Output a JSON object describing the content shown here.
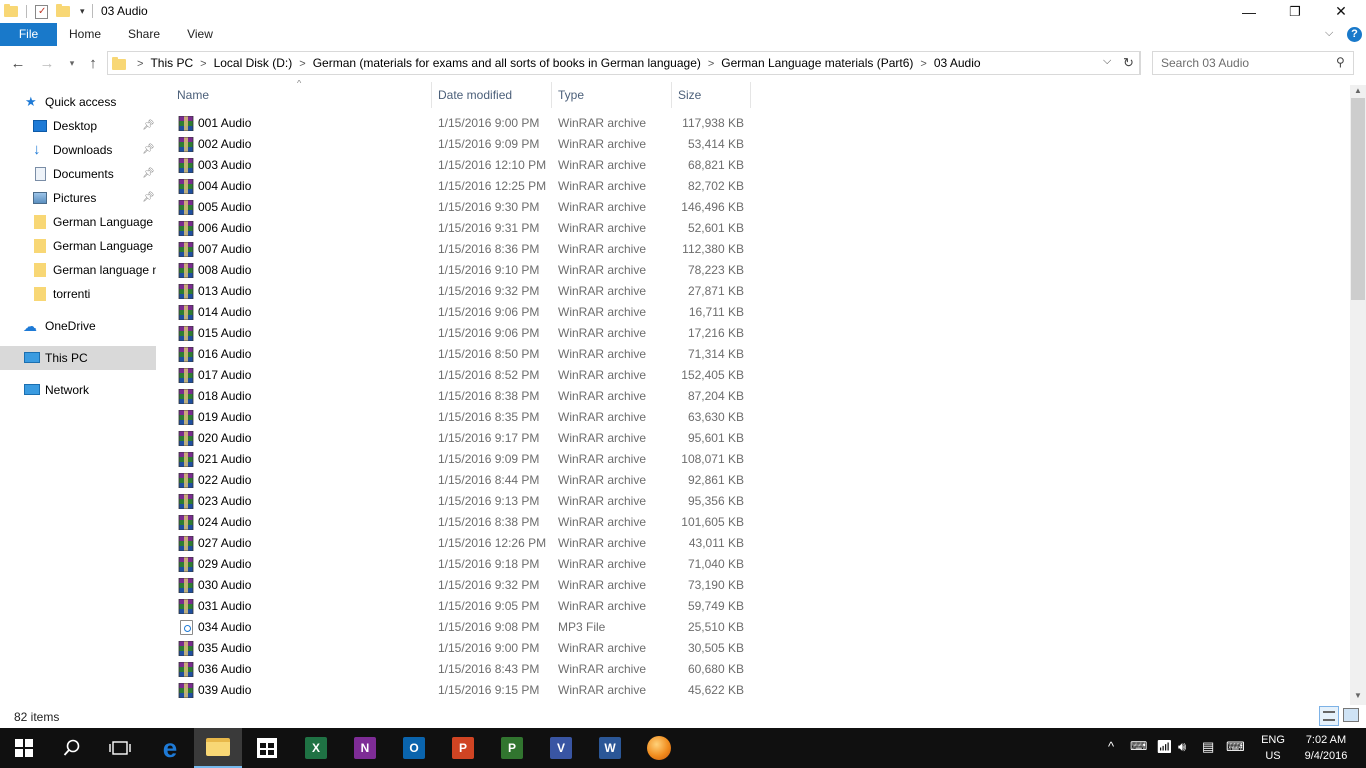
{
  "window": {
    "title": "03 Audio",
    "minimize_glyph": "—",
    "restore_glyph": "❐",
    "close_glyph": "✕",
    "help_glyph": "?",
    "ribbon_expand_glyph": "⌵"
  },
  "ribbon": {
    "tabs": [
      "File",
      "Home",
      "Share",
      "View"
    ]
  },
  "address": {
    "breadcrumbs": [
      "This PC",
      "Local Disk (D:)",
      "German (materials for exams and all sorts of books in German language)",
      "German Language materials (Part6)",
      "03 Audio"
    ],
    "search_placeholder": "Search 03 Audio"
  },
  "nav": {
    "quick_access": "Quick access",
    "items": [
      {
        "label": "Desktop",
        "icon": "desktop-icon",
        "pinned": true
      },
      {
        "label": "Downloads",
        "icon": "downloads-icon",
        "pinned": true
      },
      {
        "label": "Documents",
        "icon": "documents-icon",
        "pinned": true
      },
      {
        "label": "Pictures",
        "icon": "pictures-icon",
        "pinned": true
      },
      {
        "label": "German Language r",
        "icon": "folder-icon",
        "pinned": false
      },
      {
        "label": "German Language r",
        "icon": "folder-icon",
        "pinned": false
      },
      {
        "label": "German language n",
        "icon": "folder-icon",
        "pinned": false
      },
      {
        "label": "torrenti",
        "icon": "folder-icon",
        "pinned": false
      }
    ],
    "onedrive": "OneDrive",
    "this_pc": "This PC",
    "network": "Network"
  },
  "columns": {
    "name": "Name",
    "date": "Date modified",
    "type": "Type",
    "size": "Size"
  },
  "files": [
    {
      "name": "001 Audio",
      "date": "1/15/2016 9:00 PM",
      "type": "WinRAR archive",
      "size": "117,938 KB",
      "icon": "rar"
    },
    {
      "name": "002 Audio",
      "date": "1/15/2016 9:09 PM",
      "type": "WinRAR archive",
      "size": "53,414 KB",
      "icon": "rar"
    },
    {
      "name": "003 Audio",
      "date": "1/15/2016 12:10 PM",
      "type": "WinRAR archive",
      "size": "68,821 KB",
      "icon": "rar"
    },
    {
      "name": "004 Audio",
      "date": "1/15/2016 12:25 PM",
      "type": "WinRAR archive",
      "size": "82,702 KB",
      "icon": "rar"
    },
    {
      "name": "005 Audio",
      "date": "1/15/2016 9:30 PM",
      "type": "WinRAR archive",
      "size": "146,496 KB",
      "icon": "rar"
    },
    {
      "name": "006 Audio",
      "date": "1/15/2016 9:31 PM",
      "type": "WinRAR archive",
      "size": "52,601 KB",
      "icon": "rar"
    },
    {
      "name": "007 Audio",
      "date": "1/15/2016 8:36 PM",
      "type": "WinRAR archive",
      "size": "112,380 KB",
      "icon": "rar"
    },
    {
      "name": "008 Audio",
      "date": "1/15/2016 9:10 PM",
      "type": "WinRAR archive",
      "size": "78,223 KB",
      "icon": "rar"
    },
    {
      "name": "013 Audio",
      "date": "1/15/2016 9:32 PM",
      "type": "WinRAR archive",
      "size": "27,871 KB",
      "icon": "rar"
    },
    {
      "name": "014 Audio",
      "date": "1/15/2016 9:06 PM",
      "type": "WinRAR archive",
      "size": "16,711 KB",
      "icon": "rar"
    },
    {
      "name": "015 Audio",
      "date": "1/15/2016 9:06 PM",
      "type": "WinRAR archive",
      "size": "17,216 KB",
      "icon": "rar"
    },
    {
      "name": "016 Audio",
      "date": "1/15/2016 8:50 PM",
      "type": "WinRAR archive",
      "size": "71,314 KB",
      "icon": "rar"
    },
    {
      "name": "017 Audio",
      "date": "1/15/2016 8:52 PM",
      "type": "WinRAR archive",
      "size": "152,405 KB",
      "icon": "rar"
    },
    {
      "name": "018 Audio",
      "date": "1/15/2016 8:38 PM",
      "type": "WinRAR archive",
      "size": "87,204 KB",
      "icon": "rar"
    },
    {
      "name": "019 Audio",
      "date": "1/15/2016 8:35 PM",
      "type": "WinRAR archive",
      "size": "63,630 KB",
      "icon": "rar"
    },
    {
      "name": "020 Audio",
      "date": "1/15/2016 9:17 PM",
      "type": "WinRAR archive",
      "size": "95,601 KB",
      "icon": "rar"
    },
    {
      "name": "021 Audio",
      "date": "1/15/2016 9:09 PM",
      "type": "WinRAR archive",
      "size": "108,071 KB",
      "icon": "rar"
    },
    {
      "name": "022 Audio",
      "date": "1/15/2016 8:44 PM",
      "type": "WinRAR archive",
      "size": "92,861 KB",
      "icon": "rar"
    },
    {
      "name": "023 Audio",
      "date": "1/15/2016 9:13 PM",
      "type": "WinRAR archive",
      "size": "95,356 KB",
      "icon": "rar"
    },
    {
      "name": "024 Audio",
      "date": "1/15/2016 8:38 PM",
      "type": "WinRAR archive",
      "size": "101,605 KB",
      "icon": "rar"
    },
    {
      "name": "027 Audio",
      "date": "1/15/2016 12:26 PM",
      "type": "WinRAR archive",
      "size": "43,011 KB",
      "icon": "rar"
    },
    {
      "name": "029 Audio",
      "date": "1/15/2016 9:18 PM",
      "type": "WinRAR archive",
      "size": "71,040 KB",
      "icon": "rar"
    },
    {
      "name": "030 Audio",
      "date": "1/15/2016 9:32 PM",
      "type": "WinRAR archive",
      "size": "73,190 KB",
      "icon": "rar"
    },
    {
      "name": "031 Audio",
      "date": "1/15/2016 9:05 PM",
      "type": "WinRAR archive",
      "size": "59,749 KB",
      "icon": "rar"
    },
    {
      "name": "034 Audio",
      "date": "1/15/2016 9:08 PM",
      "type": "MP3 File",
      "size": "25,510 KB",
      "icon": "mp3"
    },
    {
      "name": "035 Audio",
      "date": "1/15/2016 9:00 PM",
      "type": "WinRAR archive",
      "size": "30,505 KB",
      "icon": "rar"
    },
    {
      "name": "036 Audio",
      "date": "1/15/2016 8:43 PM",
      "type": "WinRAR archive",
      "size": "60,680 KB",
      "icon": "rar"
    },
    {
      "name": "039 Audio",
      "date": "1/15/2016 9:15 PM",
      "type": "WinRAR archive",
      "size": "45,622 KB",
      "icon": "rar"
    }
  ],
  "status": {
    "item_count": "82 items"
  },
  "taskbar": {
    "apps": [
      {
        "name": "start-button",
        "label": ""
      },
      {
        "name": "search-button",
        "label": ""
      },
      {
        "name": "task-view-button",
        "label": ""
      },
      {
        "name": "edge-app",
        "label": "e",
        "color": "#1e7ad6"
      },
      {
        "name": "file-explorer-app",
        "label": "",
        "color": "#f8d775"
      },
      {
        "name": "store-app",
        "label": "",
        "color": "#ffffff"
      },
      {
        "name": "excel-app",
        "label": "X",
        "color": "#1f7244"
      },
      {
        "name": "onenote-app",
        "label": "N",
        "color": "#7e2c96"
      },
      {
        "name": "outlook-app",
        "label": "O",
        "color": "#0a64ad"
      },
      {
        "name": "powerpoint-app",
        "label": "P",
        "color": "#d04423"
      },
      {
        "name": "project-app",
        "label": "P",
        "color": "#31752f"
      },
      {
        "name": "visio-app",
        "label": "V",
        "color": "#3955a3"
      },
      {
        "name": "word-app",
        "label": "W",
        "color": "#2b5797"
      },
      {
        "name": "media-app",
        "label": "",
        "color": "#f08c1e"
      }
    ],
    "lang_top": "ENG",
    "lang_bottom": "US",
    "time": "7:02 AM",
    "date": "9/4/2016"
  }
}
